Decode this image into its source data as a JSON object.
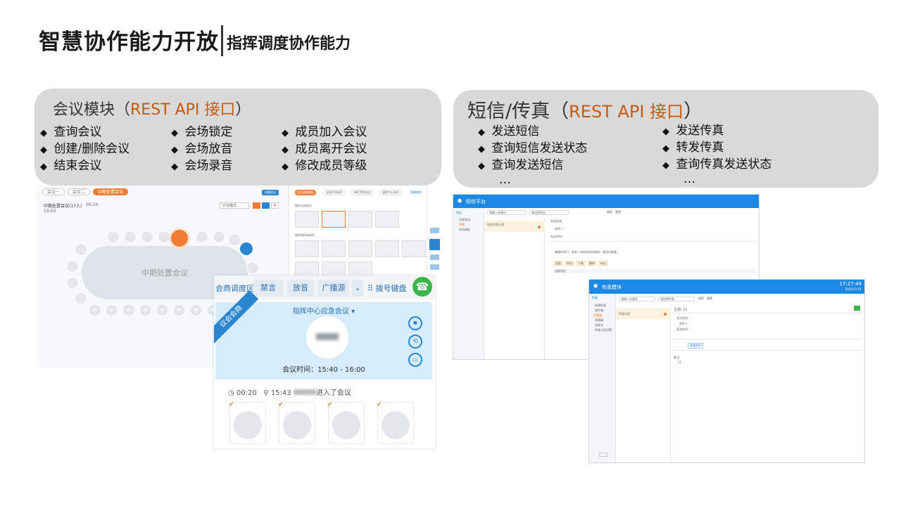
{
  "header": {
    "title": "智慧协作能力开放",
    "subtitle": "指挥调度协作能力"
  },
  "meeting_panel": {
    "title_prefix": "会议模块（",
    "title_api": "REST API 接口",
    "title_suffix": "）",
    "col1": [
      "查询会议",
      "创建/删除会议",
      "结束会议"
    ],
    "col2": [
      "会场锁定",
      "会场放音",
      "会场录音"
    ],
    "col3": [
      "成员加入会议",
      "成员离开会议",
      "修改成员等级"
    ]
  },
  "sms_panel": {
    "title_prefix": "短信/传真（",
    "title_api": "REST API 接口",
    "title_suffix": "）",
    "col1": [
      "发送短信",
      "查询短信发送状态",
      "查询发送短信"
    ],
    "col2": [
      "发送传真",
      "转发传真",
      "查询传真发送状态"
    ],
    "ellipsis": "…"
  },
  "meeting_shot": {
    "tabs": [
      "会议一",
      "会议二",
      "中期处置会议"
    ],
    "info_title": "中期处置会议(17人)",
    "info_time": "00:20",
    "info_line": "15:43",
    "layout_select": "讨论模式",
    "btn_new": "创建会议",
    "table_label": "中期处置会议",
    "right_tabs": [
      "会议调度模板",
      "全部在线成员",
      "最近常用成员",
      "调度中心成员"
    ],
    "right_link": "隐藏操作",
    "group1": "随机分组成员",
    "group2": "指挥部所有成员"
  },
  "dispatch": {
    "zone_label": "会商调度区",
    "btn_mute": "禁言",
    "btn_play": "放音",
    "btn_broadcast": "广播源",
    "btn_dial": "拨号键盘",
    "ribbon": "议会会商",
    "meeting_name": "指挥中心应急会议 ▾",
    "meeting_time": "会议时间：15:40 - 16:00",
    "log_time": "00:20",
    "log_event": "15:43",
    "log_text": "进入了会议"
  },
  "sms_shot": {
    "app_title": "短信平台",
    "nav": [
      "短信",
      "消息发送",
      "草稿",
      "短信模板"
    ],
    "search_placeholder": "请输入关键词",
    "select_placeholder": "请选择短信",
    "btn_search": "搜索",
    "btn_clear": "重置",
    "list_item": "短信内容示例",
    "field_sender": "发送状态：",
    "field_receiver": "收件人：",
    "field_time": "发送时间：",
    "body": "尊敬的用户，您有一条新的短信通知，请及时查看。",
    "actions": [
      "回复",
      "转发",
      "下载",
      "删除",
      "标记"
    ],
    "reply_hint": "回复短信"
  },
  "fax_shot": {
    "app_title": "传真模块",
    "time": "17:27:44",
    "date": "2020-01-01",
    "nav": [
      "传真",
      "新建传真",
      "收件箱",
      "已发送",
      "草稿箱",
      "回收站",
      "传真号码设置"
    ],
    "search_placeholder": "请输入关键词",
    "select_placeholder": "请选择传真",
    "btn_search": "搜索",
    "btn_clear": "重置",
    "list_item": "传真内容",
    "detail_title": "主题: 11",
    "field_status": "发送状态：",
    "field_receiver": "收件人：",
    "field_time": "发送时间：",
    "btn_attach": "查看附件",
    "note_label": "备注:",
    "note_value": "11"
  }
}
